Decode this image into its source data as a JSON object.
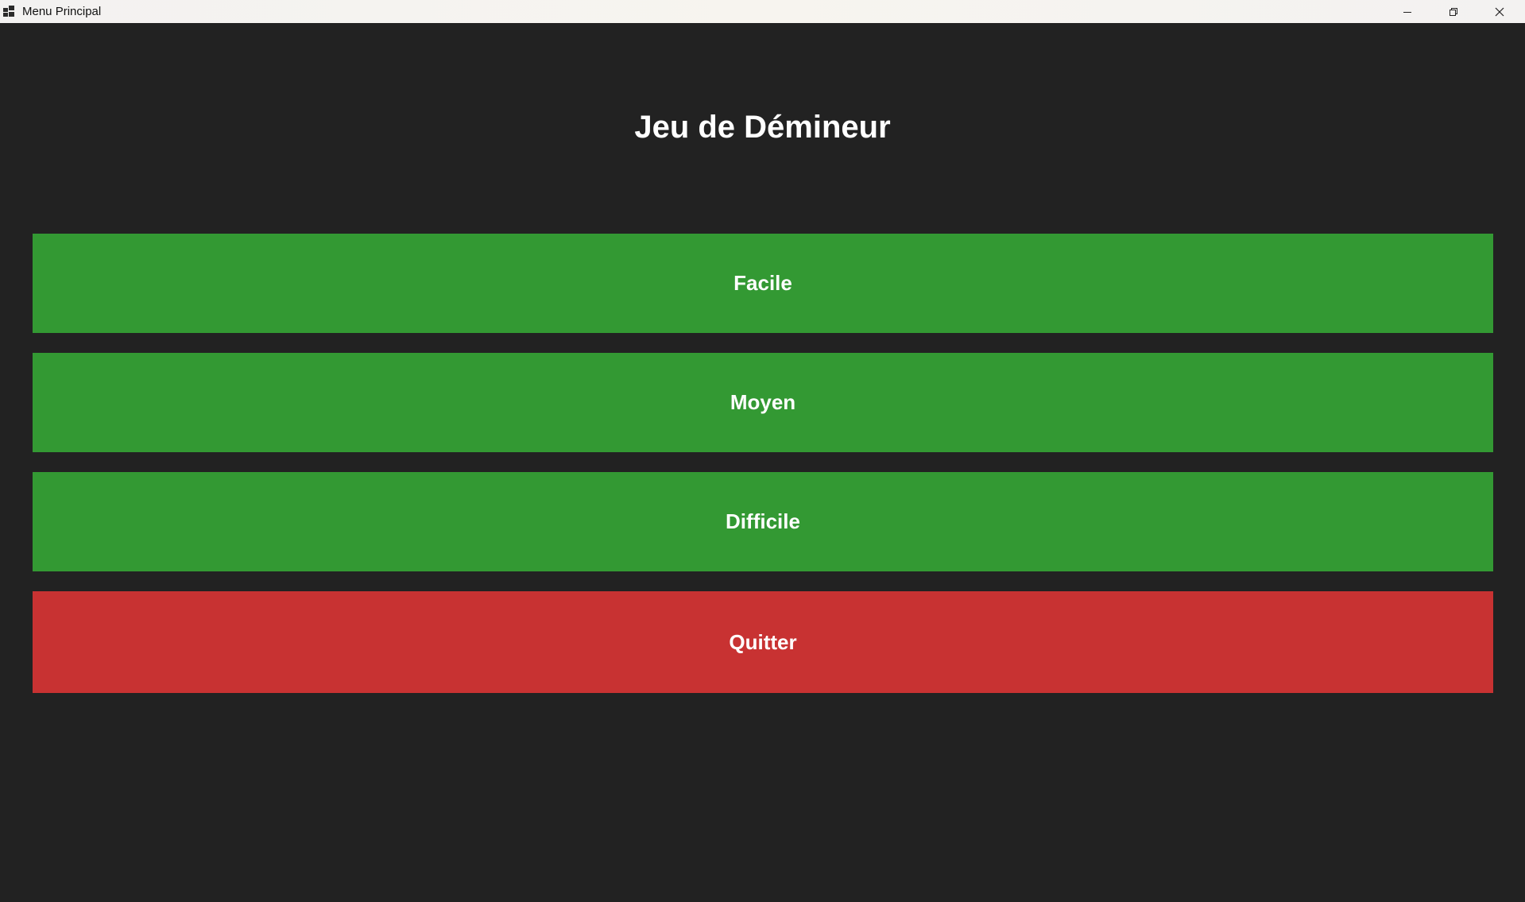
{
  "window": {
    "title": "Menu Principal",
    "controls": {
      "minimize_icon": "minimize-icon",
      "maximize_icon": "restore-icon",
      "close_icon": "close-icon"
    }
  },
  "main": {
    "heading": "Jeu de Démineur",
    "buttons": [
      {
        "label": "Facile",
        "color": "#339933"
      },
      {
        "label": "Moyen",
        "color": "#339933"
      },
      {
        "label": "Difficile",
        "color": "#339933"
      },
      {
        "label": "Quitter",
        "color": "#c83232"
      }
    ]
  },
  "colors": {
    "background": "#222222",
    "text": "#ffffff",
    "titlebar": "#f3f2f1"
  }
}
